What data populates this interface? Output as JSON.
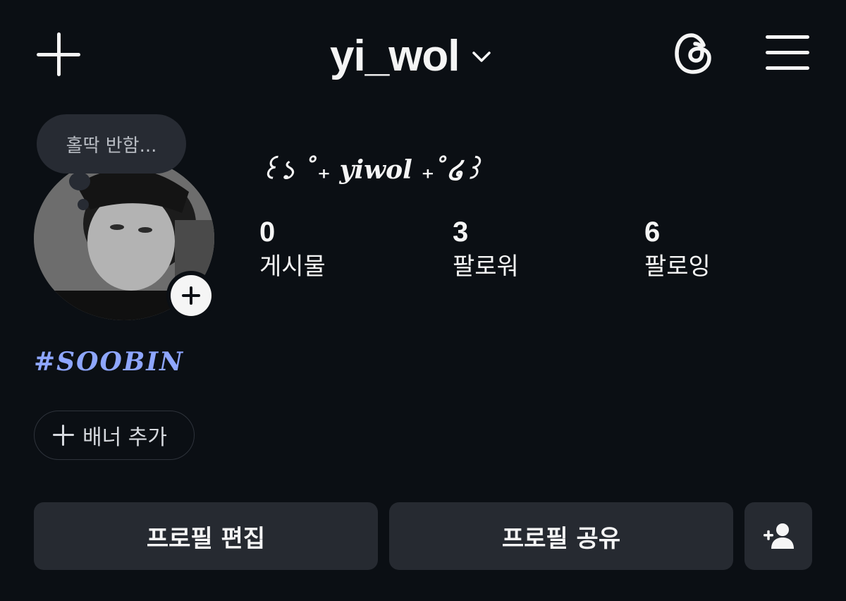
{
  "header": {
    "username": "yi_wol",
    "icons": {
      "create": "plus-icon",
      "account_switch": "chevron-down-icon",
      "threads": "threads-icon",
      "menu": "hamburger-menu-icon"
    }
  },
  "profile": {
    "note": "홀딱 반함...",
    "display_name": "꒰১ ˚₊ 𝒚𝒊𝒘𝒐𝒍 ₊˚໒꒱",
    "stats": [
      {
        "value": "0",
        "label": "게시물"
      },
      {
        "value": "3",
        "label": "팔로워"
      },
      {
        "value": "6",
        "label": "팔로잉"
      }
    ],
    "bio": "#SOOBIN",
    "bio_color": "#8ea6ff"
  },
  "banner": {
    "label": "배너 추가"
  },
  "actions": {
    "edit_label": "프로필 편집",
    "share_label": "프로필 공유",
    "suggest_icon": "add-person-icon"
  },
  "colors": {
    "background": "#0b0f14",
    "button": "#262a31",
    "text": "#f5f5f5"
  }
}
